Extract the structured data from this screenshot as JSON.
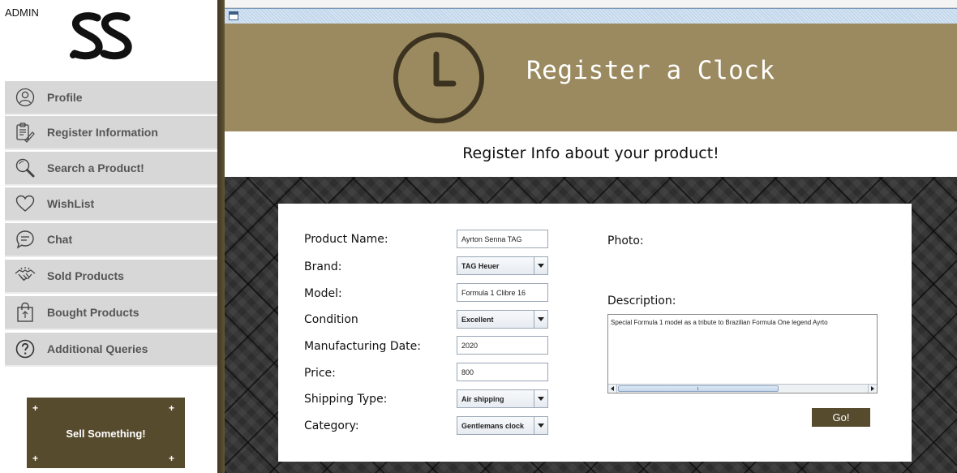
{
  "sidebar": {
    "role_label": "ADMIN",
    "logo": "SS",
    "items": [
      {
        "label": "Profile",
        "icon": "user-circle-icon"
      },
      {
        "label": "Register Information",
        "icon": "clipboard-edit-icon"
      },
      {
        "label": "Search a Product!",
        "icon": "magnifier-icon"
      },
      {
        "label": "WishList",
        "icon": "heart-icon"
      },
      {
        "label": "Chat",
        "icon": "chat-bubble-icon"
      },
      {
        "label": "Sold Products",
        "icon": "handshake-icon"
      },
      {
        "label": "Bought Products",
        "icon": "shopping-bag-icon"
      },
      {
        "label": "Additional Queries",
        "icon": "question-circle-icon"
      }
    ],
    "sell_button": {
      "label": "Sell Something!",
      "corner_mark": "+"
    }
  },
  "header": {
    "title": "Register a Clock",
    "icon": "clock-icon"
  },
  "subheader": {
    "title": "Register Info about your product!"
  },
  "form": {
    "fields": [
      {
        "label": "Product Name:",
        "value": "Ayrton Senna TAG",
        "kind": "text"
      },
      {
        "label": "Brand:",
        "value": "TAG Heuer",
        "kind": "combo"
      },
      {
        "label": "Model:",
        "value": "Formula 1 Clibre 16",
        "kind": "text"
      },
      {
        "label": "Condition",
        "value": "Excellent",
        "kind": "combo"
      },
      {
        "label": "Manufacturing Date:",
        "value": "2020",
        "kind": "text"
      },
      {
        "label": "Price:",
        "value": "800",
        "kind": "text"
      },
      {
        "label": "Shipping Type:",
        "value": "Air shipping",
        "kind": "combo"
      },
      {
        "label": "Category:",
        "value": "Gentlemans clock",
        "kind": "combo"
      }
    ],
    "photo_label": "Photo:",
    "description_label": "Description:",
    "description_value": "Special Formula 1 model as a tribute to Brazilian Formula One legend Ayrto",
    "go_label": "Go!"
  },
  "colors": {
    "accent_dark": "#574b2d",
    "header_bg": "#9b8a5f",
    "sidebar_item_bg": "#d7d7d7",
    "pattern_bg": "#2e2e2e"
  }
}
